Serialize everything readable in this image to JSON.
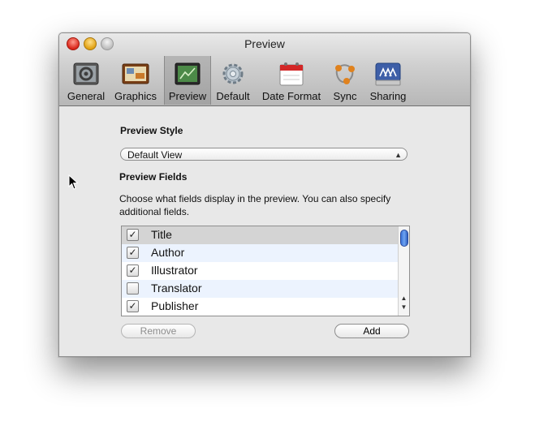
{
  "window": {
    "title": "Preview"
  },
  "toolbar": {
    "items": [
      {
        "label": "General",
        "icon": "general-icon"
      },
      {
        "label": "Graphics",
        "icon": "graphics-icon"
      },
      {
        "label": "Preview",
        "icon": "preview-icon",
        "selected": true
      },
      {
        "label": "Default",
        "icon": "gear-icon"
      },
      {
        "label": "Date Format",
        "icon": "calendar-icon"
      },
      {
        "label": "Sync",
        "icon": "sync-icon"
      },
      {
        "label": "Sharing",
        "icon": "sharing-icon"
      }
    ]
  },
  "preview_style": {
    "heading": "Preview Style",
    "selected": "Default View"
  },
  "preview_fields": {
    "heading": "Preview Fields",
    "description": "Choose what fields display in the preview. You can also specify additional fields.",
    "fields": [
      {
        "label": "Title",
        "checked": true
      },
      {
        "label": "Author",
        "checked": true
      },
      {
        "label": "Illustrator",
        "checked": true
      },
      {
        "label": "Translator",
        "checked": false
      },
      {
        "label": "Publisher",
        "checked": true
      }
    ]
  },
  "buttons": {
    "remove": "Remove",
    "add": "Add"
  },
  "colors": {
    "accent_blue": "#3a72d8",
    "row_stripe": "#ecf3fe",
    "selection_gray": "#d4d4d4"
  }
}
